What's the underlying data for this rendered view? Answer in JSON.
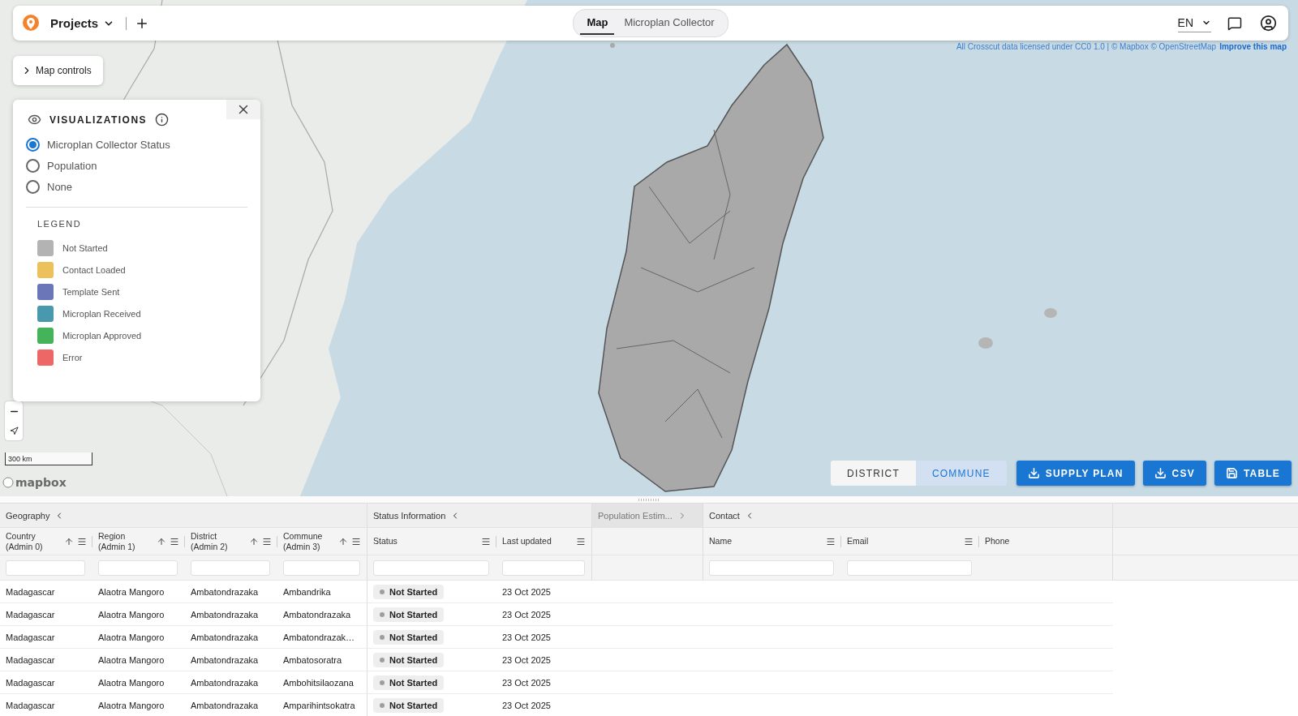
{
  "top_bar": {
    "project_menu": "Projects",
    "view_tabs": [
      {
        "label": "Map",
        "selected": true
      },
      {
        "label": "Microplan Collector",
        "selected": false
      }
    ],
    "language": "EN"
  },
  "map": {
    "controls_button": "Map controls",
    "attribution": "All Crosscut data licensed under CC0 1.0 | © Mapbox © OpenStreetMap",
    "attribution_link": "Improve this map",
    "scale": "300 km",
    "logo": "mapbox"
  },
  "visualizations": {
    "title": "VISUALIZATIONS",
    "options": [
      {
        "label": "Microplan Collector Status",
        "selected": true
      },
      {
        "label": "Population",
        "selected": false
      },
      {
        "label": "None",
        "selected": false
      }
    ],
    "legend_title": "LEGEND",
    "legend": [
      {
        "label": "Not Started",
        "color": "#b3b3b3"
      },
      {
        "label": "Contact Loaded",
        "color": "#ecc15c"
      },
      {
        "label": "Template Sent",
        "color": "#6b76b8"
      },
      {
        "label": "Microplan Received",
        "color": "#4899ae"
      },
      {
        "label": "Microplan Approved",
        "color": "#45b35a"
      },
      {
        "label": "Error",
        "color": "#ee6767"
      }
    ]
  },
  "level_toggle": [
    {
      "label": "DISTRICT",
      "selected": false
    },
    {
      "label": "COMMUNE",
      "selected": true
    }
  ],
  "actions": [
    {
      "label": "SUPPLY PLAN",
      "kind": "download"
    },
    {
      "label": "CSV",
      "kind": "download"
    },
    {
      "label": "TABLE",
      "kind": "save"
    }
  ],
  "table": {
    "groups": [
      {
        "label": "Geography",
        "expanded": true,
        "columns": [
          {
            "label": "Country",
            "sublabel": "(Admin 0)",
            "sortable": true,
            "menu": true,
            "filterable": true
          },
          {
            "label": "Region",
            "sublabel": "(Admin 1)",
            "sortable": true,
            "menu": true,
            "filterable": true
          },
          {
            "label": "District",
            "sublabel": "(Admin 2)",
            "sortable": true,
            "menu": true,
            "filterable": true
          },
          {
            "label": "Commune",
            "sublabel": "(Admin 3)",
            "sortable": true,
            "menu": true,
            "filterable": true
          }
        ]
      },
      {
        "label": "Status Information",
        "expanded": true,
        "columns": [
          {
            "label": "Status",
            "kind": "status",
            "sortable": false,
            "menu": true,
            "filterable": true
          },
          {
            "label": "Last updated",
            "sortable": false,
            "menu": true,
            "filterable": true
          }
        ]
      },
      {
        "label": "Population Estim...",
        "expanded": false,
        "columns": [
          {
            "sortable": false,
            "menu": false,
            "filterable": false
          }
        ]
      },
      {
        "label": "Contact",
        "expanded": true,
        "columns": [
          {
            "label": "Name",
            "sortable": false,
            "menu": true,
            "filterable": true
          },
          {
            "label": "Email",
            "sortable": false,
            "menu": true,
            "filterable": true
          },
          {
            "label": "Phone",
            "sortable": false,
            "menu": false,
            "filterable": false
          }
        ]
      }
    ],
    "rows": [
      {
        "cells": [
          "Madagascar",
          "Alaotra Mangoro",
          "Ambatondrazaka",
          "Ambandrika",
          "Not Started",
          "23 Oct 2025"
        ]
      },
      {
        "cells": [
          "Madagascar",
          "Alaotra Mangoro",
          "Ambatondrazaka",
          "Ambatondrazaka",
          "Not Started",
          "23 Oct 2025"
        ]
      },
      {
        "cells": [
          "Madagascar",
          "Alaotra Mangoro",
          "Ambatondrazaka",
          "Ambatondrazak…",
          "Not Started",
          "23 Oct 2025"
        ]
      },
      {
        "cells": [
          "Madagascar",
          "Alaotra Mangoro",
          "Ambatondrazaka",
          "Ambatosoratra",
          "Not Started",
          "23 Oct 2025"
        ]
      },
      {
        "cells": [
          "Madagascar",
          "Alaotra Mangoro",
          "Ambatondrazaka",
          "Ambohitsilaozana",
          "Not Started",
          "23 Oct 2025"
        ]
      },
      {
        "cells": [
          "Madagascar",
          "Alaotra Mangoro",
          "Ambatondrazaka",
          "Amparihintsokatra",
          "Not Started",
          "23 Oct 2025"
        ]
      }
    ]
  }
}
